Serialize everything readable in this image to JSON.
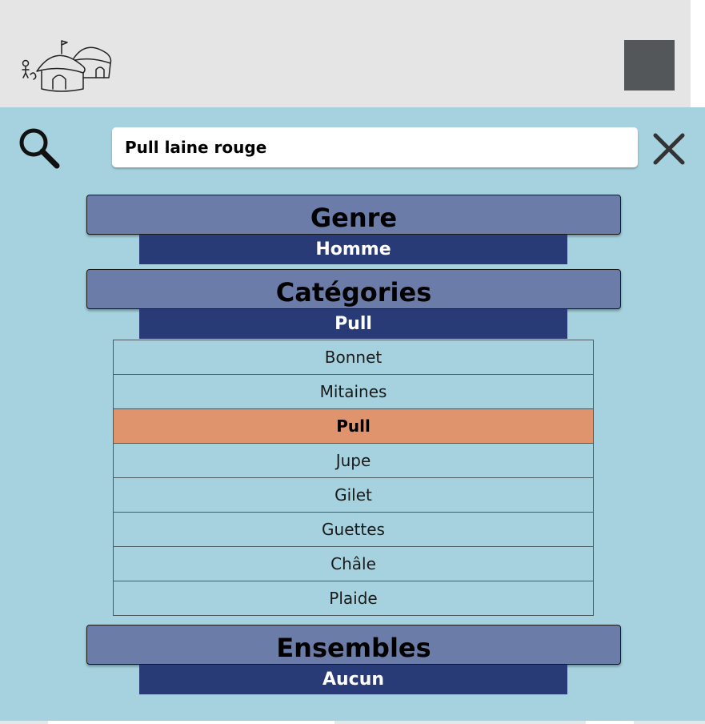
{
  "header": {
    "logo_icon": "village-huts-logo",
    "menu_button_color": "#545759"
  },
  "search": {
    "value": "Pull laine rouge",
    "icon": "search-icon",
    "close_icon": "close-icon"
  },
  "filters": {
    "genre": {
      "label": "Genre",
      "value": "Homme"
    },
    "categories": {
      "label": "Catégories",
      "value": "Pull",
      "options": [
        {
          "label": "Bonnet",
          "selected": false
        },
        {
          "label": "Mitaines",
          "selected": false
        },
        {
          "label": "Pull",
          "selected": true
        },
        {
          "label": "Jupe",
          "selected": false
        },
        {
          "label": "Gilet",
          "selected": false
        },
        {
          "label": "Guettes",
          "selected": false
        },
        {
          "label": "Châle",
          "selected": false
        },
        {
          "label": "Plaide",
          "selected": false
        }
      ]
    },
    "ensembles": {
      "label": "Ensembles",
      "value": "Aucun"
    }
  },
  "colors": {
    "panel_background": "#a5d2de",
    "section_header": "#6c7ca8",
    "section_value": "#283b77",
    "selected_option": "#e0946e",
    "topbar": "#e5e5e5"
  }
}
